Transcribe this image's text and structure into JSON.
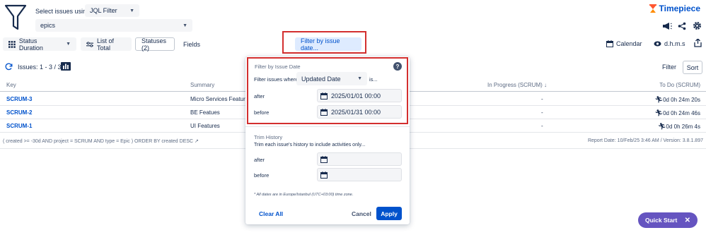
{
  "filter_bar": {
    "select_label": "Select issues using",
    "jql_select": "JQL Filter",
    "filter_select": "epics"
  },
  "brand": {
    "name": "Timepiece",
    "color": "#0052cc",
    "accent": "#ff5630"
  },
  "toolbar": {
    "status_duration": "Status Duration",
    "list_of_total": "List of Total",
    "statuses": "Statuses (2)",
    "fields": "Fields",
    "filter_by_date": "Filter by issue date...",
    "calendar": "Calendar",
    "dhms": "d.h.m.s"
  },
  "results": {
    "count_label": "Issues: 1 - 3 / 3",
    "filter_btn": "Filter",
    "sort_btn": "Sort"
  },
  "table": {
    "headers": {
      "key": "Key",
      "summary": "Summary",
      "in_progress": "In Progress (SCRUM)",
      "todo": "To Do (SCRUM)"
    },
    "rows": [
      {
        "key": "SCRUM-3",
        "summary": "Micro Services Features",
        "in_progress": "-",
        "todo": "0d 0h 24m 20s"
      },
      {
        "key": "SCRUM-2",
        "summary": "BE Featues",
        "in_progress": "-",
        "todo": "0d 0h 24m 46s"
      },
      {
        "key": "SCRUM-1",
        "summary": "UI Features",
        "in_progress": "-",
        "todo": "0d 0h 26m 4s"
      }
    ],
    "jql": "( created >= -30d AND project = SCRUM AND type = Epic ) ORDER BY created DESC",
    "report_date": "Report Date: 10/Feb/25 3:46 AM / Version: 3.8.1.897"
  },
  "popup": {
    "issue_title": "Filter by Issue Date",
    "filter_where": "Filter issues where",
    "date_type": "Updated Date",
    "is_suffix": "is...",
    "after_label": "after",
    "after_value": "2025/01/01 00:00",
    "before_label": "before",
    "before_value": "2025/01/31 00:00",
    "trim_title": "Trim History",
    "trim_desc": "Trim each issue's history to include activities only...",
    "trim_after_label": "after",
    "trim_after_value": "",
    "trim_before_label": "before",
    "trim_before_value": "",
    "note": "* All dates are in Europe/Istanbul (UTC+03:00) time zone.",
    "clear_all": "Clear All",
    "cancel": "Cancel",
    "apply": "Apply"
  },
  "quick_start": {
    "label": "Quick Start",
    "color": "#6554c0"
  },
  "colors": {
    "highlight": "#d32f2f",
    "primary": "#0052cc"
  }
}
